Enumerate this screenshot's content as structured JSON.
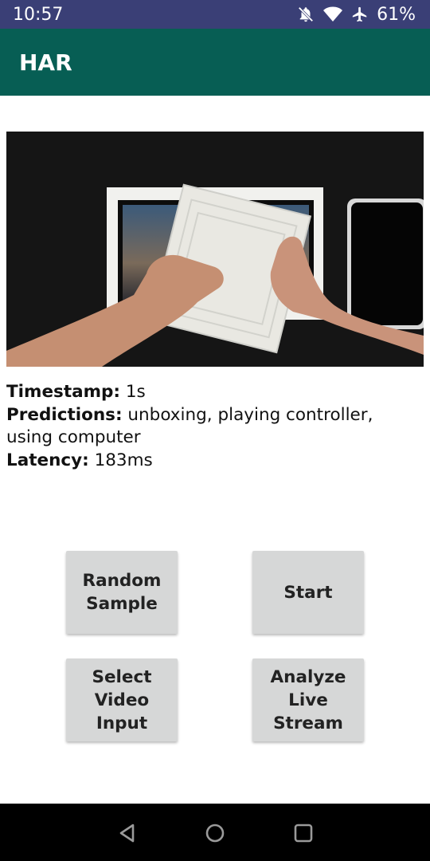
{
  "status_bar": {
    "time": "10:57",
    "battery": "61%",
    "icons": [
      "notifications-off-icon",
      "wifi-icon",
      "airplane-mode-icon"
    ]
  },
  "app_bar": {
    "title": "HAR"
  },
  "info": {
    "timestamp_label": "Timestamp:",
    "timestamp_value": " 1s",
    "predictions_label": "Predictions:",
    "predictions_value": " unboxing, playing controller, using computer",
    "latency_label": "Latency:",
    "latency_value": " 183ms"
  },
  "buttons": {
    "random_sample": "Random\nSample",
    "start": "Start",
    "select_video_input": "Select\nVideo\nInput",
    "analyze_live_stream": "Analyze\nLive\nStream"
  },
  "nav_bar": {
    "icons": [
      "back-icon",
      "home-icon",
      "recents-icon"
    ]
  },
  "colors": {
    "status_bar": "#3a3f76",
    "app_bar": "#075e54",
    "button": "#d6d7d7"
  }
}
